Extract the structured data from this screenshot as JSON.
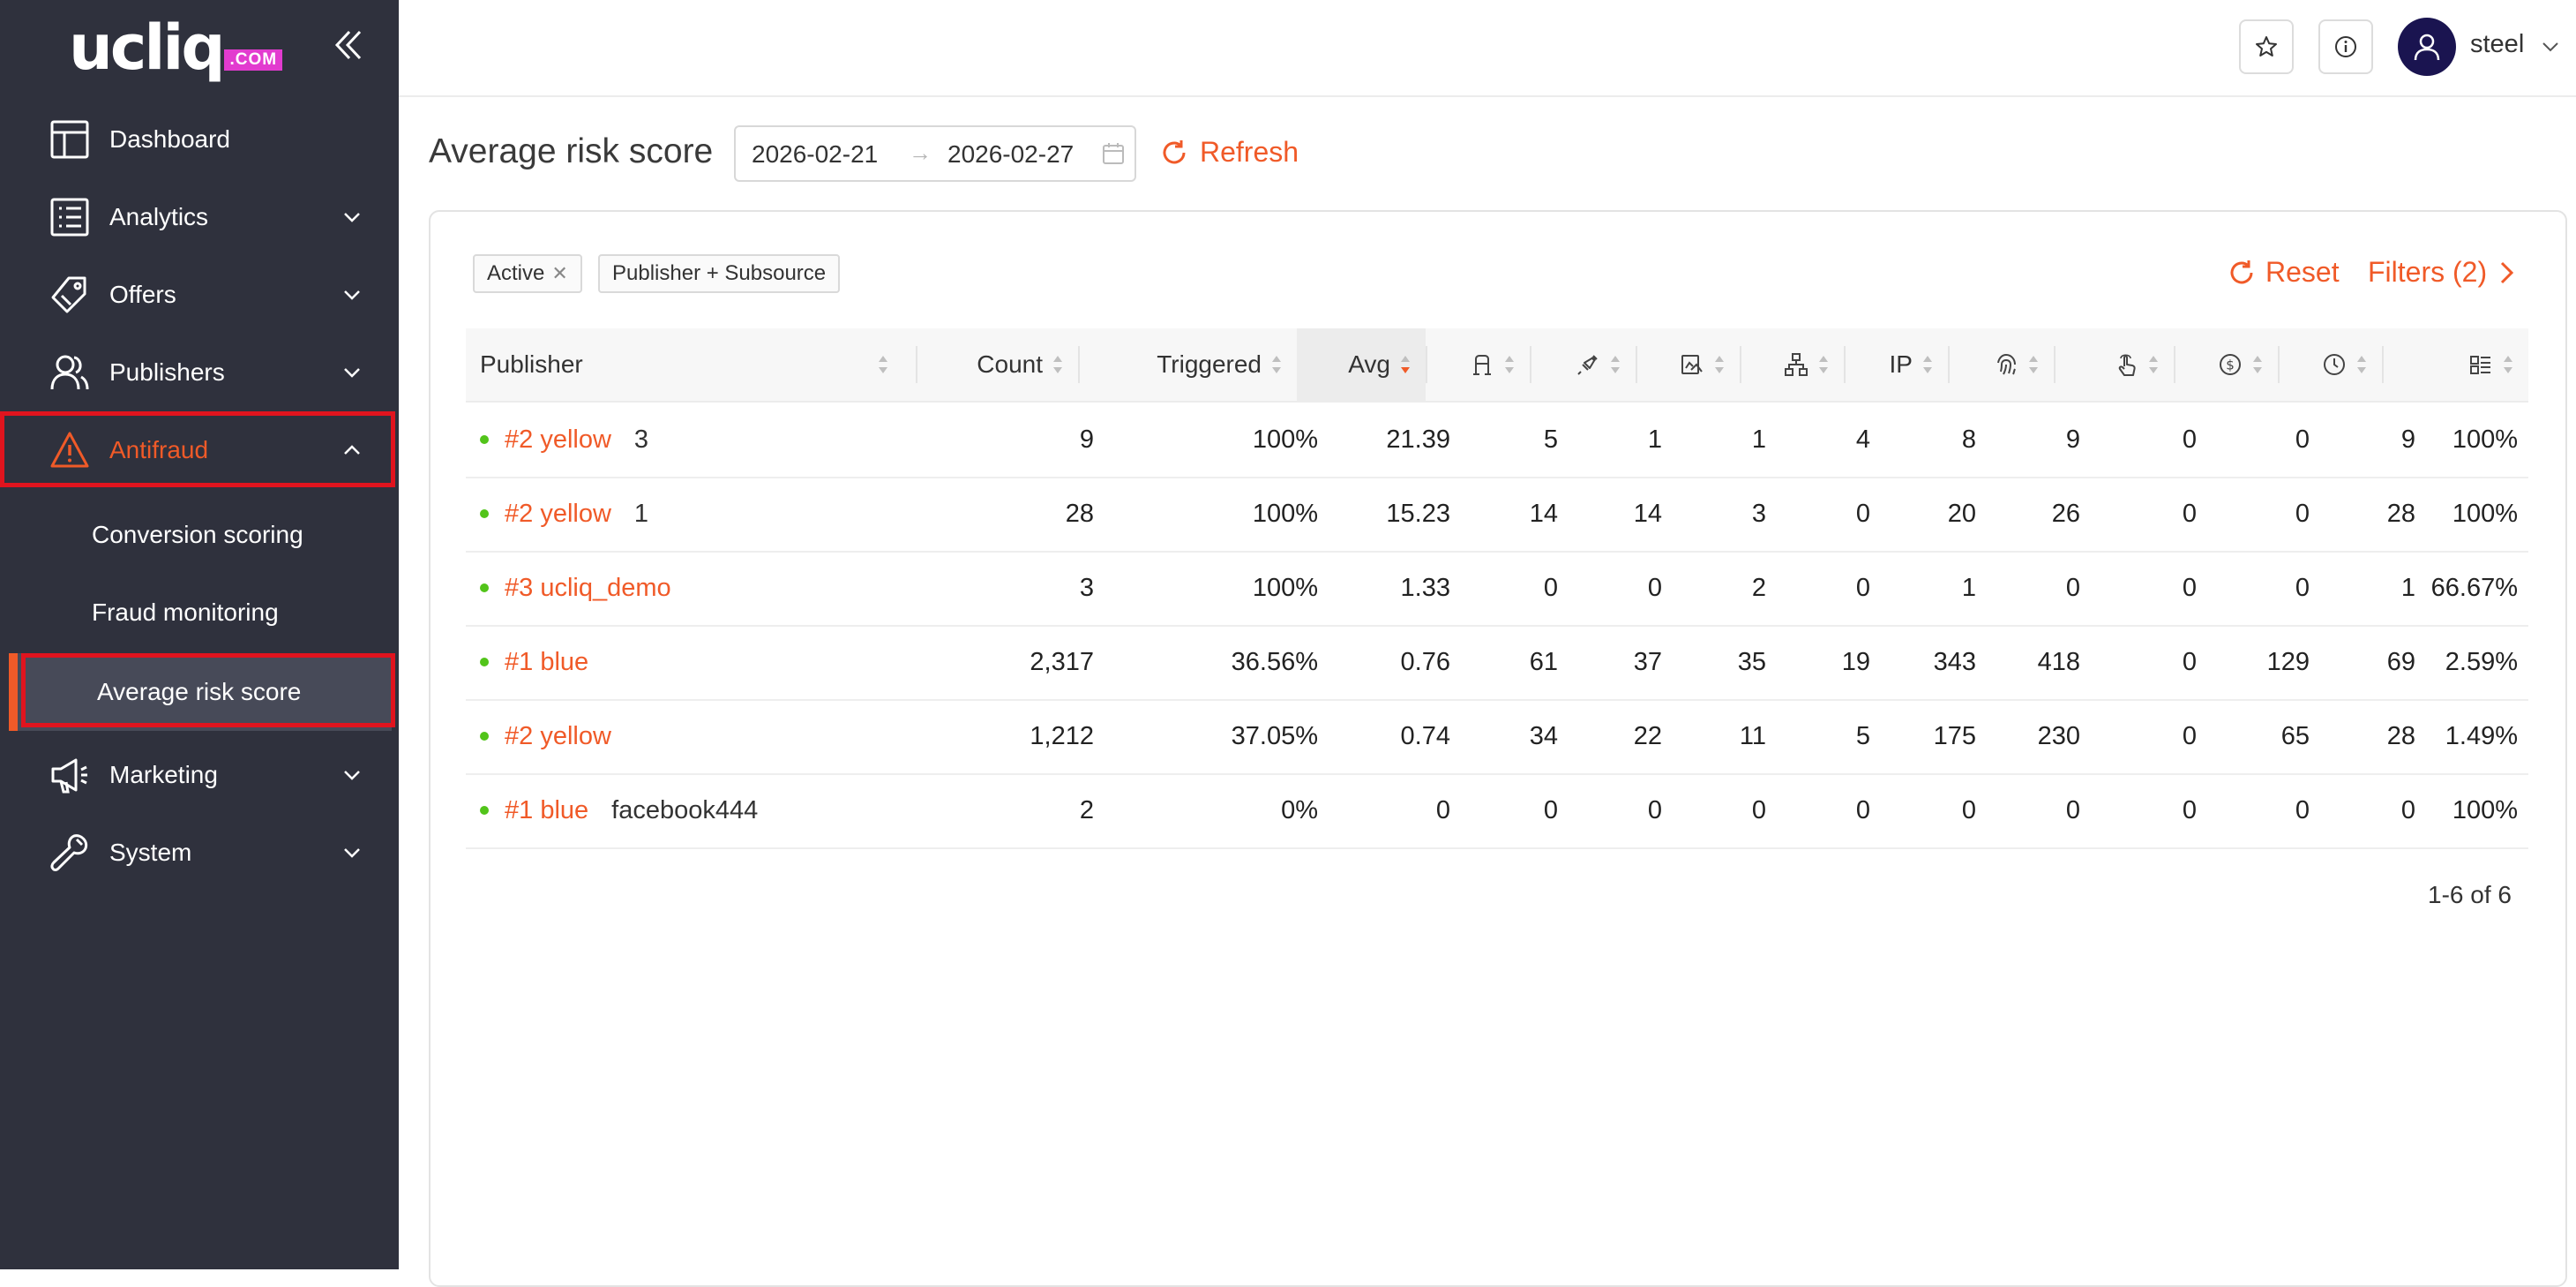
{
  "brand": {
    "logo_text": "ucliq",
    "logo_suffix": ".COM",
    "accent": "#f05a28",
    "sidebar_bg": "#2f313d",
    "highlight": "#e0141e"
  },
  "sidebar": {
    "items": [
      {
        "label": "Dashboard",
        "icon": "dashboard-icon"
      },
      {
        "label": "Analytics",
        "icon": "analytics-icon"
      },
      {
        "label": "Offers",
        "icon": "tag-icon"
      },
      {
        "label": "Publishers",
        "icon": "users-icon"
      },
      {
        "label": "Antifraud",
        "icon": "warning-icon"
      },
      {
        "label": "Marketing",
        "icon": "megaphone-icon"
      },
      {
        "label": "System",
        "icon": "wrench-icon"
      }
    ],
    "antifraud_sub": [
      {
        "label": "Conversion scoring"
      },
      {
        "label": "Fraud monitoring"
      },
      {
        "label": "Average risk score"
      }
    ]
  },
  "header": {
    "username": "steel"
  },
  "page": {
    "title": "Average risk score",
    "date_from": "2026-02-21",
    "date_to": "2026-02-27",
    "date_separator": "→",
    "refresh_label": "Refresh",
    "reset_label": "Reset",
    "filters_label": "Filters (2)"
  },
  "tags": [
    {
      "label": "Active"
    },
    {
      "label": "Publisher + Subsource"
    }
  ],
  "table": {
    "headers": {
      "publisher": "Publisher",
      "count": "Count",
      "triggered": "Triggered",
      "avg": "Avg",
      "ip": "IP"
    },
    "icon_columns": [
      "bot-icon",
      "injection-icon",
      "click-fraud-icon",
      "hierarchy-icon",
      "fingerprint-icon",
      "tap-icon",
      "dollar-icon",
      "clock-icon",
      "layout-icon"
    ],
    "rows": [
      {
        "publisher": "#2 yellow",
        "subsource": "3",
        "count": "9",
        "triggered": "100%",
        "avg": "21.39",
        "c1": "5",
        "c2": "1",
        "c3": "1",
        "c4": "4",
        "ip": "8",
        "c6": "9",
        "c7": "0",
        "c8": "0",
        "c9": "9",
        "c10": "100%"
      },
      {
        "publisher": "#2 yellow",
        "subsource": "1",
        "count": "28",
        "triggered": "100%",
        "avg": "15.23",
        "c1": "14",
        "c2": "14",
        "c3": "3",
        "c4": "0",
        "ip": "20",
        "c6": "26",
        "c7": "0",
        "c8": "0",
        "c9": "28",
        "c10": "100%"
      },
      {
        "publisher": "#3 ucliq_demo",
        "subsource": "",
        "count": "3",
        "triggered": "100%",
        "avg": "1.33",
        "c1": "0",
        "c2": "0",
        "c3": "2",
        "c4": "0",
        "ip": "1",
        "c6": "0",
        "c7": "0",
        "c8": "0",
        "c9": "1",
        "c10": "66.67%"
      },
      {
        "publisher": "#1 blue",
        "subsource": "",
        "count": "2,317",
        "triggered": "36.56%",
        "avg": "0.76",
        "c1": "61",
        "c2": "37",
        "c3": "35",
        "c4": "19",
        "ip": "343",
        "c6": "418",
        "c7": "0",
        "c8": "129",
        "c9": "69",
        "c10": "2.59%"
      },
      {
        "publisher": "#2 yellow",
        "subsource": "",
        "count": "1,212",
        "triggered": "37.05%",
        "avg": "0.74",
        "c1": "34",
        "c2": "22",
        "c3": "11",
        "c4": "5",
        "ip": "175",
        "c6": "230",
        "c7": "0",
        "c8": "65",
        "c9": "28",
        "c10": "1.49%"
      },
      {
        "publisher": "#1 blue",
        "subsource": "facebook444",
        "count": "2",
        "triggered": "0%",
        "avg": "0",
        "c1": "0",
        "c2": "0",
        "c3": "0",
        "c4": "0",
        "ip": "0",
        "c6": "0",
        "c7": "0",
        "c8": "0",
        "c9": "0",
        "c10": "100%"
      }
    ],
    "pagination": "1-6 of 6"
  }
}
